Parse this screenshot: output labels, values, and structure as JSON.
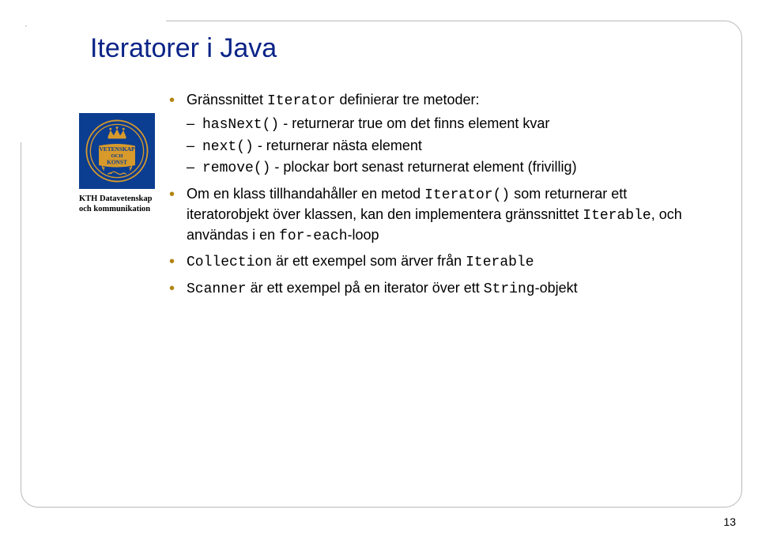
{
  "title": "Iteratorer i Java",
  "logo": {
    "line1": "KTH Datavetenskap",
    "line2": "och kommunikation",
    "banner_top": "VETENSKAP",
    "banner_mid": "OCH",
    "banner_bot": "KONST",
    "crest_bg": "#0b3d91",
    "crest_fg": "#d79a2b"
  },
  "b1": {
    "pre": "Gränssnittet ",
    "code": "Iterator",
    "post": " definierar tre metoder:"
  },
  "b1s1": {
    "code": "hasNext()",
    "post": " - returnerar true om det finns element kvar"
  },
  "b1s2": {
    "code": "next()",
    "post": " - returnerar nästa element"
  },
  "b1s3": {
    "code": "remove()",
    "post": " - plockar bort senast returnerat element (frivillig)"
  },
  "b2": {
    "pre": "Om en klass tillhandahåller en metod ",
    "code1": "Iterator()",
    "mid1": " som returnerar ett iteratorobjekt över klassen, kan den implementera gränssnittet ",
    "code2": "Iterable",
    "mid2": ", och användas i en ",
    "code3": "for-each",
    "post": "-loop"
  },
  "b3": {
    "code1": "Collection",
    "mid": " är ett exempel som ärver från ",
    "code2": "Iterable"
  },
  "b4": {
    "code1": "Scanner",
    "mid": " är ett exempel på en iterator över ett ",
    "code2": "String",
    "post": "-objekt"
  },
  "page_number": "13"
}
